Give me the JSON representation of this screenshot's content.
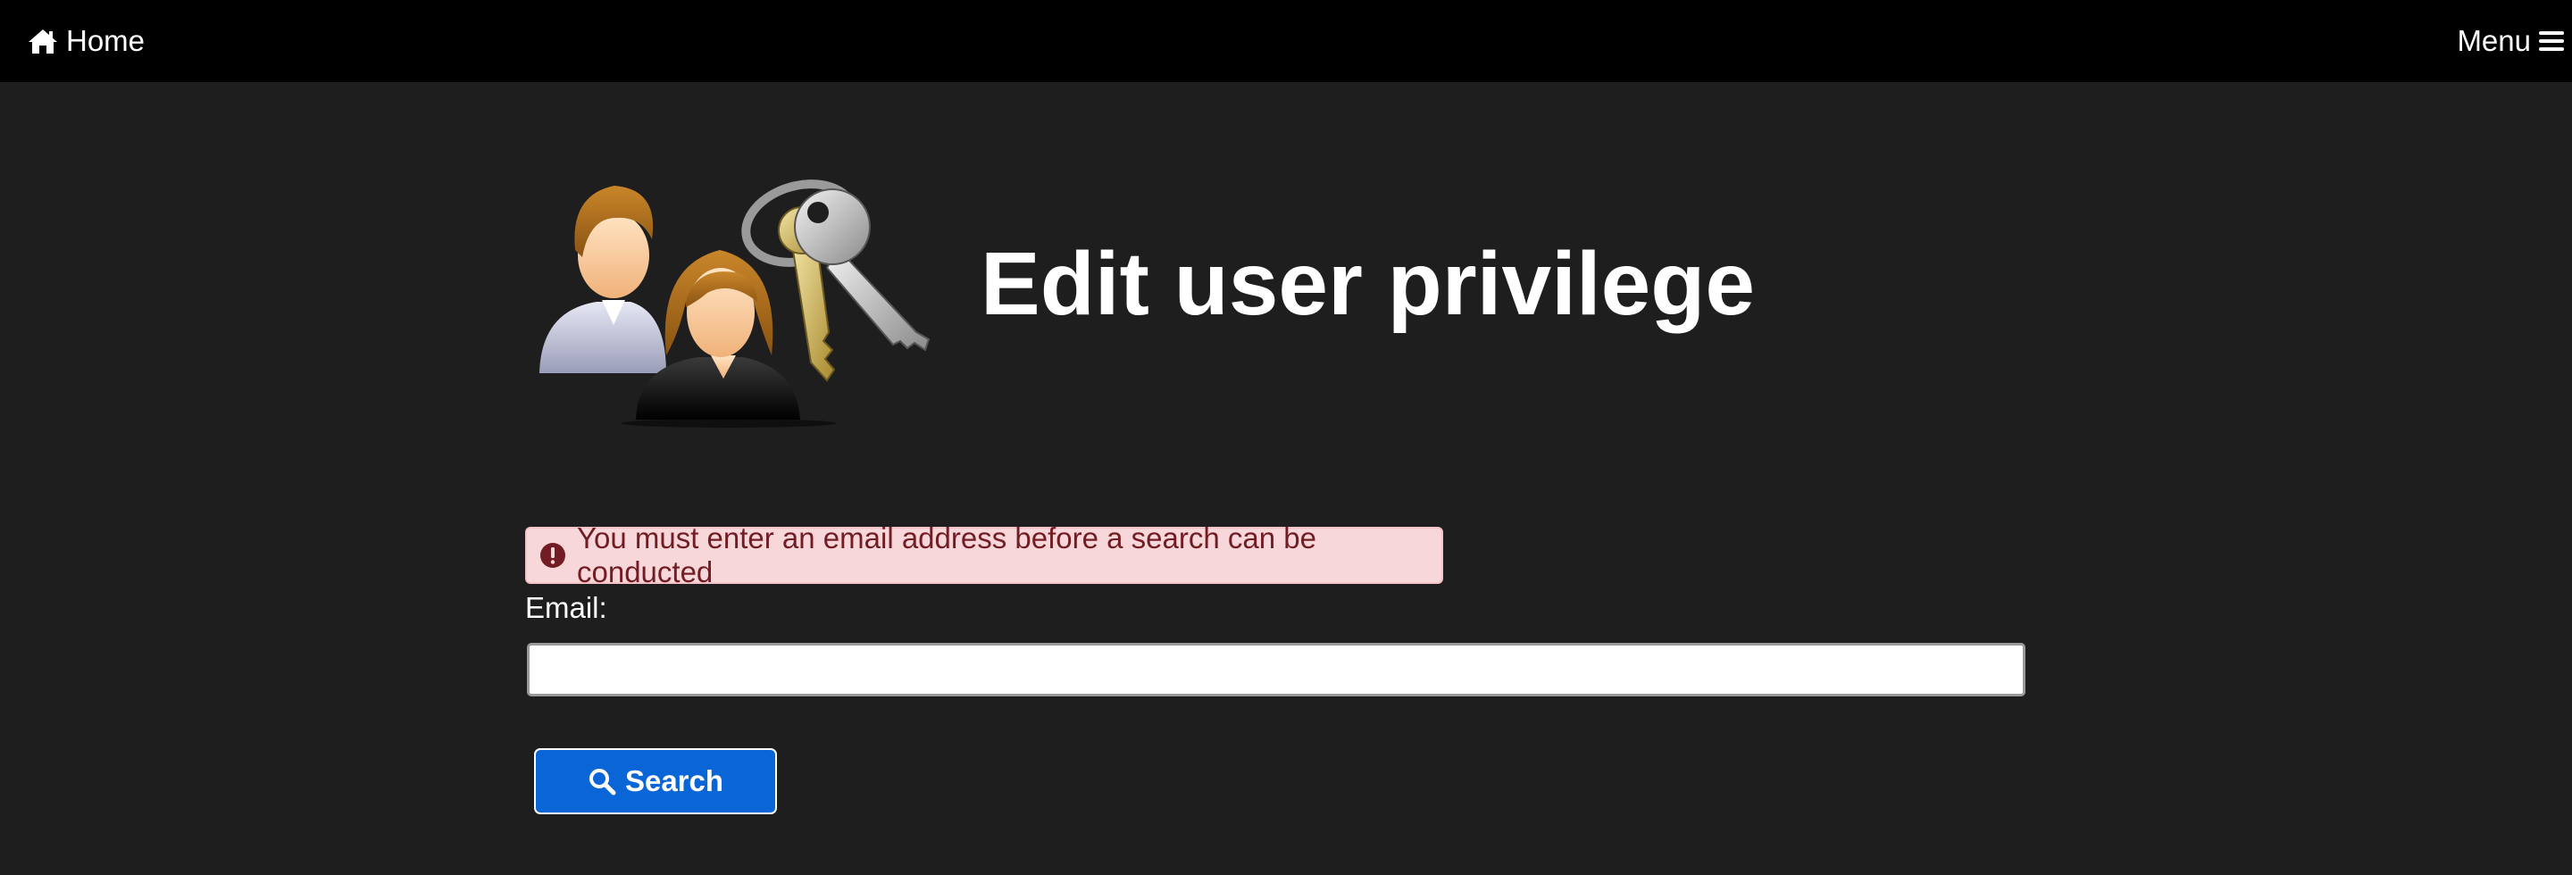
{
  "nav": {
    "home_label": "Home",
    "menu_label": "Menu"
  },
  "header": {
    "title": "Edit user privilege",
    "icon": "users-keys-icon"
  },
  "alert": {
    "message": "You must enter an email address before a search can be conducted",
    "icon": "exclamation-circle-icon"
  },
  "form": {
    "email_label": "Email:",
    "email_value": "",
    "search_label": "Search",
    "search_icon": "search-icon"
  },
  "colors": {
    "topbar": "#000000",
    "background": "#1e1e1e",
    "alert_bg": "#f8d7da",
    "alert_text": "#721c24",
    "button_bg": "#0a66d6"
  }
}
